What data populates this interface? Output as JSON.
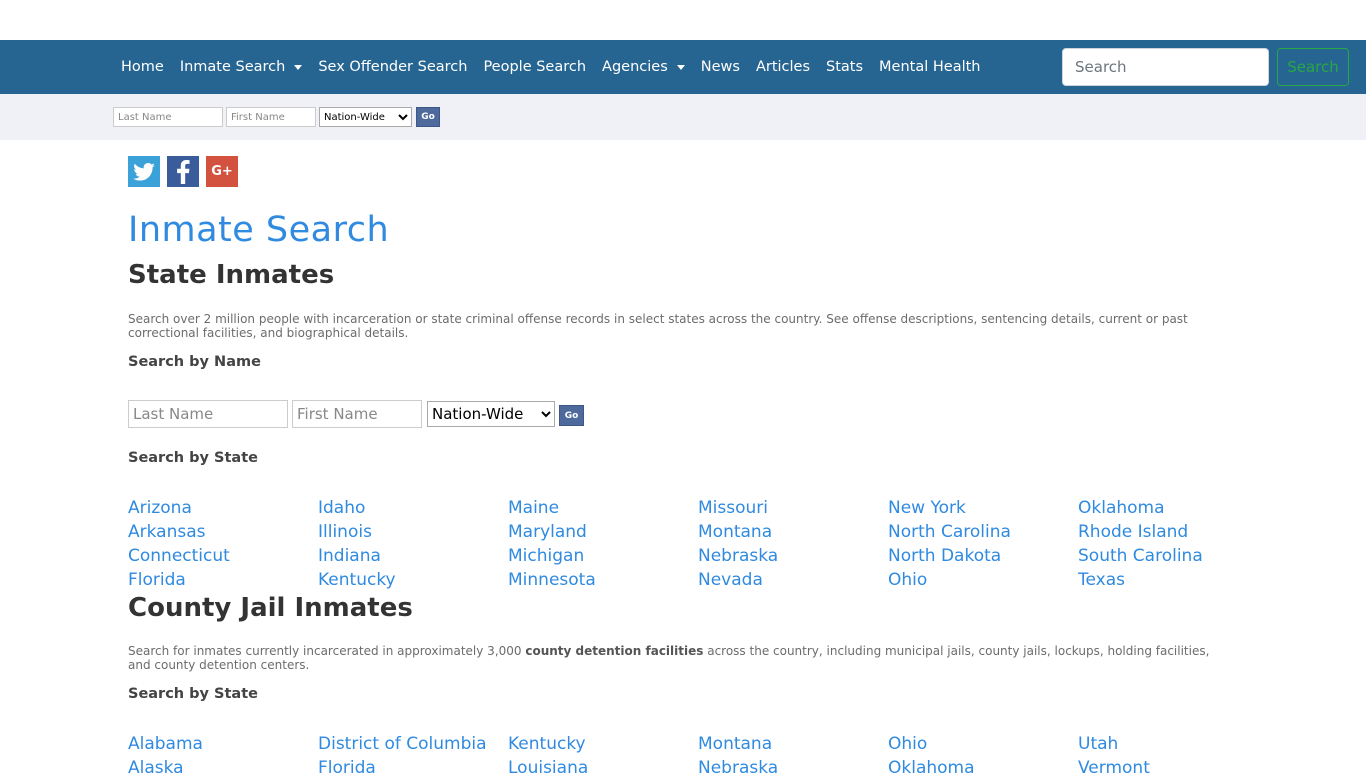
{
  "nav": {
    "items": [
      {
        "label": "Home",
        "dropdown": false
      },
      {
        "label": "Inmate Search",
        "dropdown": true
      },
      {
        "label": "Sex Offender Search",
        "dropdown": false
      },
      {
        "label": "People Search",
        "dropdown": false
      },
      {
        "label": "Agencies",
        "dropdown": true
      },
      {
        "label": "News",
        "dropdown": false
      },
      {
        "label": "Articles",
        "dropdown": false
      },
      {
        "label": "Stats",
        "dropdown": false
      },
      {
        "label": "Mental Health",
        "dropdown": false
      }
    ],
    "search_placeholder": "Search",
    "search_button": "Search"
  },
  "subbar": {
    "last_name_placeholder": "Last Name",
    "first_name_placeholder": "First Name",
    "scope_value": "Nation-Wide",
    "go_label": "Go"
  },
  "social": {
    "twitter": "twitter-icon",
    "facebook": "facebook-icon",
    "google_plus": "google-plus-icon"
  },
  "page_title": "Inmate Search",
  "state_section": {
    "heading": "State Inmates",
    "description": "Search over 2 million people with incarceration or state criminal offense records in select states across the country. See offense descriptions, sentencing details, current or past correctional facilities, and biographical details.",
    "search_by_name": "Search by Name",
    "last_name_placeholder": "Last Name",
    "first_name_placeholder": "First Name",
    "scope_value": "Nation-Wide",
    "go_label": "Go",
    "search_by_state": "Search by State",
    "states": [
      "Arizona",
      "Idaho",
      "Maine",
      "Missouri",
      "New York",
      "Oklahoma",
      "Arkansas",
      "Illinois",
      "Maryland",
      "Montana",
      "North Carolina",
      "Rhode Island",
      "Connecticut",
      "Indiana",
      "Michigan",
      "Nebraska",
      "North Dakota",
      "South Carolina",
      "Florida",
      "Kentucky",
      "Minnesota",
      "Nevada",
      "Ohio",
      "Texas"
    ]
  },
  "county_section": {
    "heading": "County Jail Inmates",
    "description_before": "Search for inmates currently incarcerated in approximately 3,000 ",
    "description_bold": "county detention facilities",
    "description_after": " across the country, including municipal jails, county jails, lockups, holding facilities, and county detention centers.",
    "search_by_state": "Search by State",
    "states": [
      "Alabama",
      "District of Columbia",
      "Kentucky",
      "Montana",
      "Ohio",
      "Utah",
      "Alaska",
      "Florida",
      "Louisiana",
      "Nebraska",
      "Oklahoma",
      "Vermont"
    ]
  }
}
